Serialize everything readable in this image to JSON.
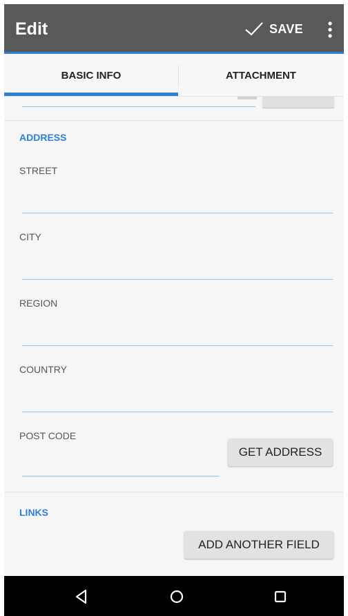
{
  "app_bar": {
    "title": "Edit",
    "save_label": "SAVE",
    "save_icon": "checkmark-icon",
    "more_icon": "more-vert-icon"
  },
  "tabs": [
    {
      "label": "BASIC INFO",
      "selected": true
    },
    {
      "label": "ATTACHMENT",
      "selected": false
    }
  ],
  "address": {
    "section_title": "ADDRESS",
    "fields": [
      {
        "label": "STREET",
        "value": ""
      },
      {
        "label": "CITY",
        "value": ""
      },
      {
        "label": "REGION",
        "value": ""
      },
      {
        "label": "COUNTRY",
        "value": ""
      },
      {
        "label": "POST CODE",
        "value": ""
      }
    ],
    "get_address_label": "GET ADDRESS"
  },
  "links": {
    "section_title": "LINKS",
    "add_field_label": "ADD ANOTHER FIELD"
  },
  "nav": {
    "back_icon": "back-triangle-icon",
    "home_icon": "home-circle-icon",
    "recents_icon": "recents-square-icon"
  },
  "colors": {
    "app_bar": "#595959",
    "accent": "#2e7fd6",
    "field_line": "#8ec1ef",
    "background": "#f6f6f6",
    "nav_bar": "#000000"
  }
}
